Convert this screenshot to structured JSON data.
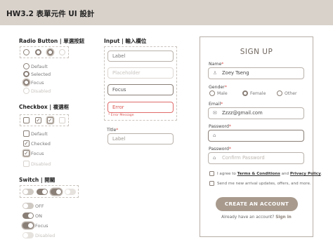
{
  "header": {
    "title": "HW3.2 表單元件 UI 設計"
  },
  "radio_section": {
    "title": "Radio Button | 單選按鈕",
    "states": [
      "Default",
      "Selected",
      "Focus",
      "Disabled"
    ]
  },
  "checkbox_section": {
    "title": "Checkbox | 複選框",
    "states": [
      "Default",
      "Checked",
      "Focus",
      "Disabled"
    ]
  },
  "switch_section": {
    "title": "Switch | 開關",
    "states": [
      "OFF",
      "ON",
      "Focus",
      "Disabled"
    ]
  },
  "input_section": {
    "title": "Input | 輸入欄位",
    "fields": {
      "label_value": "Label",
      "placeholder_value": "Placeholder",
      "focus_value": "Focus",
      "error_value": "Error",
      "error_message": "* Error Message"
    },
    "titled_field": {
      "title": "Title",
      "required_mark": "*",
      "placeholder": "Label"
    }
  },
  "signup": {
    "title": "SIGN UP",
    "name": {
      "label": "Name",
      "value": "Zoey Tseng"
    },
    "gender": {
      "label": "Gender",
      "options": [
        "Male",
        "Female",
        "Other"
      ],
      "selected": "Female"
    },
    "email": {
      "label": "Email",
      "value": "Zzzz@gmail.com"
    },
    "password": {
      "label": "Password",
      "value": ""
    },
    "confirm": {
      "label": "Password",
      "placeholder": "Confirm Password"
    },
    "required_mark": "*",
    "agree": {
      "prefix": "I agree to ",
      "terms": "Terms & Conditions",
      "and": " and ",
      "privacy": "Privacy Policy",
      "suffix": "."
    },
    "newsletter": "Send me new arrival updates, offers, and more.",
    "cta": "CREATE AN ACCOUNT",
    "footer": {
      "text": "Already have an account?",
      "link": "Sign in"
    }
  },
  "colors": {
    "accent": "#8a7f77",
    "header_bg": "#d9d2cb",
    "cta_bg": "#a89a8d",
    "error": "#e06a6a"
  }
}
